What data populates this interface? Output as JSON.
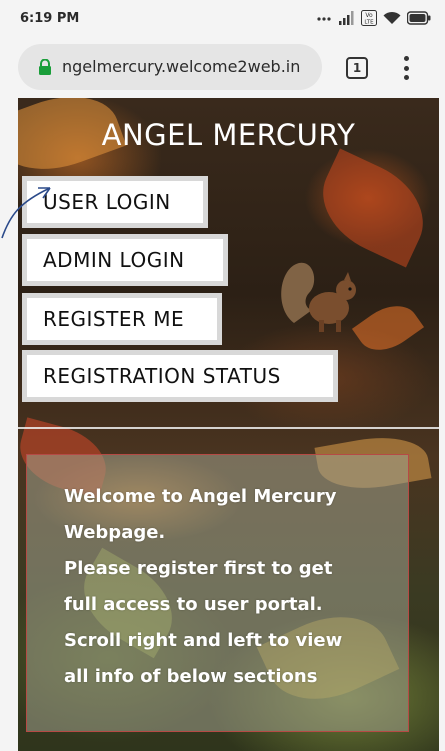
{
  "status_bar": {
    "time": "6:19 PM",
    "icons": [
      "dots-icon",
      "signal-icon",
      "volte-icon",
      "wifi-icon",
      "battery-icon"
    ],
    "volte_label": "Vo LTE"
  },
  "browser": {
    "url": "ngelmercury.welcome2web.in",
    "tab_count": "1"
  },
  "site": {
    "title": "ANGEL MERCURY",
    "nav": [
      {
        "label": "USER LOGIN"
      },
      {
        "label": "ADMIN LOGIN"
      },
      {
        "label": "REGISTER ME"
      },
      {
        "label": "REGISTRATION STATUS"
      }
    ],
    "welcome_lines": [
      "Welcome to Angel Mercury",
      "Webpage.",
      "Please register first to get",
      "full access to user portal.",
      "Scroll right and left to view",
      "all info of below sections"
    ]
  },
  "colors": {
    "button_border": "#d8d8d8",
    "box_border": "#b64a45",
    "annotation_arrow": "#2b4a8a"
  }
}
